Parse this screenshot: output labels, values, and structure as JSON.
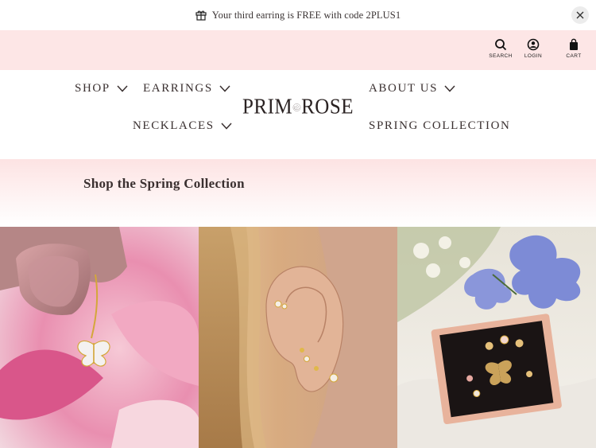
{
  "announcement": {
    "icon": "gift-icon",
    "text": "Your third earring is FREE with code 2PLUS1",
    "close_icon": "close-icon"
  },
  "utility": {
    "search_label": "SEARCH",
    "login_label": "LOGIN",
    "cart_label": "CART"
  },
  "nav": {
    "shop": "SHOP",
    "earrings": "EARRINGS",
    "necklaces": "NECKLACES",
    "about": "ABOUT US",
    "spring": "SPRING COLLECTION"
  },
  "logo": {
    "left": "PRIM",
    "right": "ROSE",
    "icon": "rose-icon"
  },
  "hero": {
    "title": "Shop the Spring Collection"
  },
  "tiles": [
    {
      "name": "butterfly-pendant-photo"
    },
    {
      "name": "ear-stack-photo"
    },
    {
      "name": "gift-box-photo"
    }
  ],
  "colors": {
    "announcement_bg": "#ffffff",
    "utility_bg": "#fde6e6",
    "hero_gradient_top": "#fde3e3",
    "text": "#3a3030"
  }
}
